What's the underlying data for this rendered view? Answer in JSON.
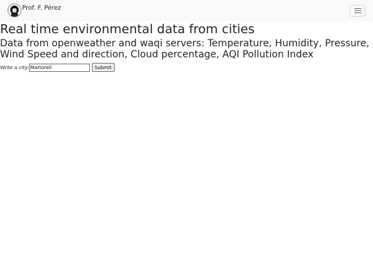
{
  "navbar": {
    "brand_text": "Prof. F. Pérez",
    "logo_icon": "professor-avatar-icon",
    "toggler_icon": "hamburger-menu-icon"
  },
  "main": {
    "title": "Real time environmental data from cities",
    "subtitle": "Data from openweather and waqi servers: Temperature, Humidity, Pressure, Wind Speed and direction, Cloud percentage, AQI Pollution Index"
  },
  "form": {
    "label": "Write a city:",
    "city_value": "Martorell",
    "submit_label": "Submit"
  }
}
